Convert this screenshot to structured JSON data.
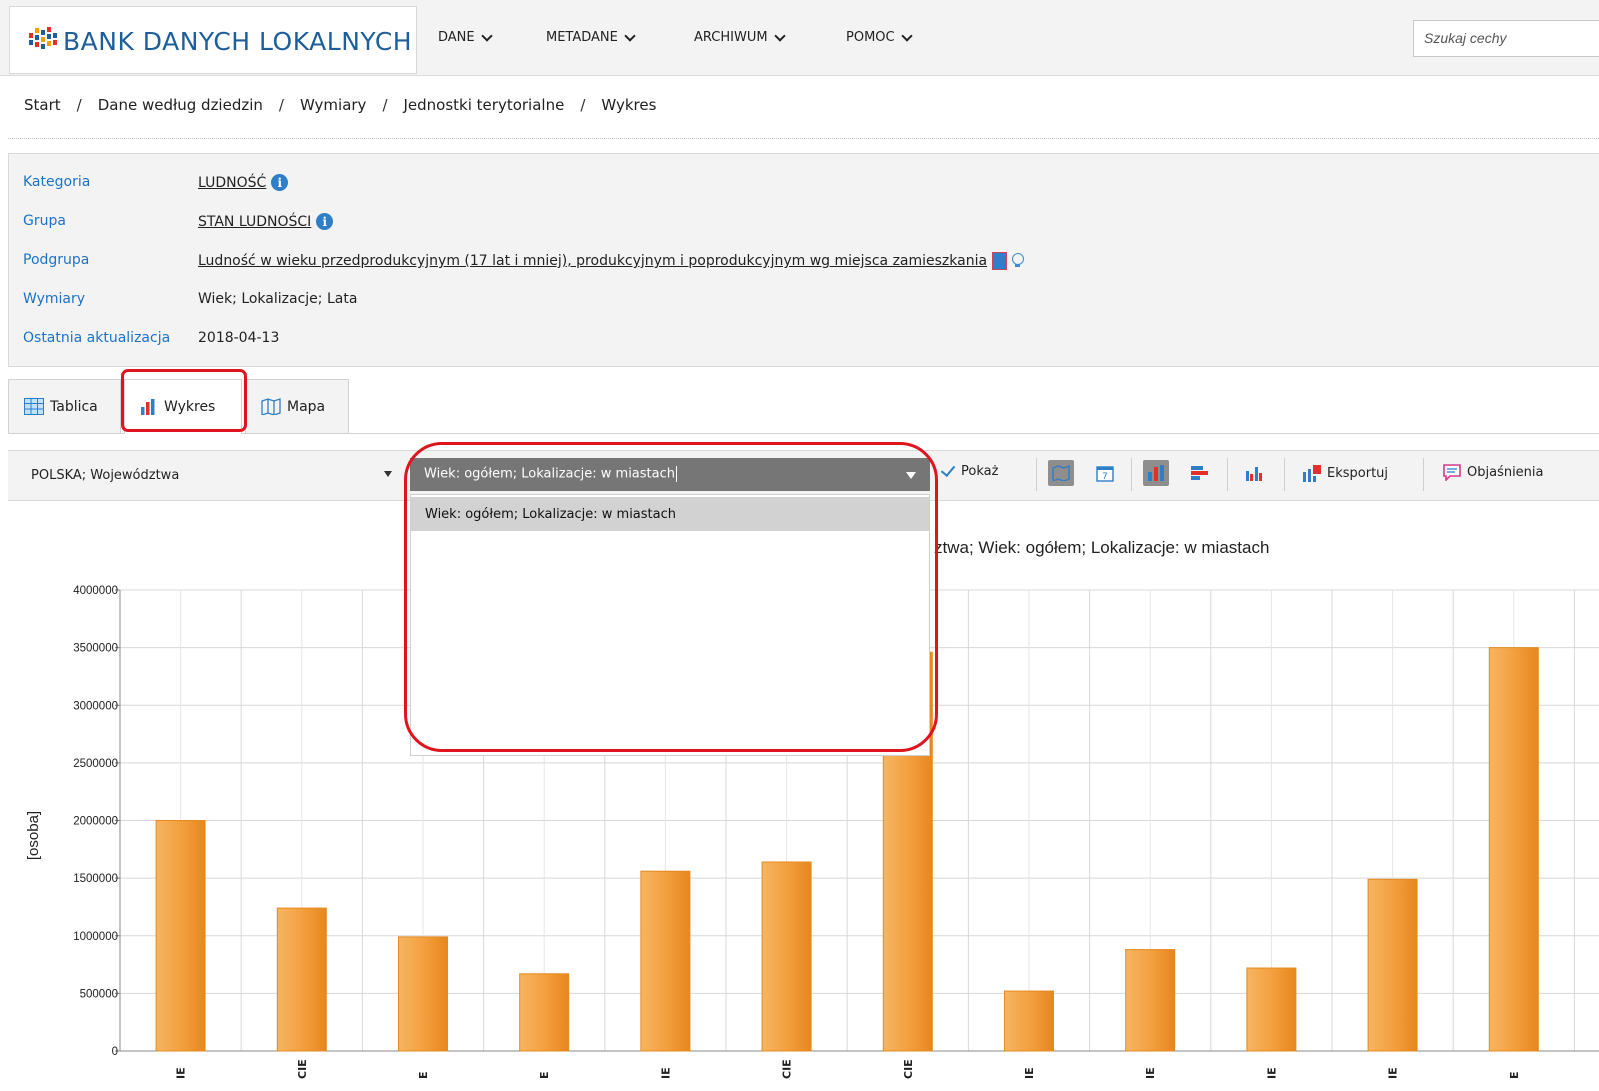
{
  "header": {
    "logo_text": "BANK DANYCH LOKALNYCH",
    "nav": [
      {
        "label": "DANE"
      },
      {
        "label": "METADANE"
      },
      {
        "label": "ARCHIWUM"
      },
      {
        "label": "POMOC"
      }
    ],
    "search_placeholder": "Szukaj cechy"
  },
  "breadcrumb": [
    "Start",
    "Dane według dziedzin",
    "Wymiary",
    "Jednostki terytorialne",
    "Wykres"
  ],
  "meta": {
    "kategoria_label": "Kategoria",
    "kategoria_value": "LUDNOŚĆ",
    "grupa_label": "Grupa",
    "grupa_value": "STAN LUDNOŚCI",
    "podgrupa_label": "Podgrupa",
    "podgrupa_value": "Ludność w wieku przedprodukcyjnym (17 lat i mniej), produkcyjnym i poprodukcyjnym wg miejsca zamieszkania",
    "wymiary_label": "Wymiary",
    "wymiary_value": "Wiek; Lokalizacje; Lata",
    "aktualizacja_label": "Ostatnia aktualizacja",
    "aktualizacja_value": "2018-04-13"
  },
  "tabs": [
    {
      "label": "Tablica"
    },
    {
      "label": "Wykres"
    },
    {
      "label": "Mapa"
    }
  ],
  "toolbar": {
    "territory_select": "POLSKA; Województwa",
    "dimension_select": "Wiek: ogółem; Lokalizacje: w miastach",
    "dropdown_option": "Wiek: ogółem; Lokalizacje: w miastach",
    "show_label": "Pokaż",
    "export_label": "Eksportuj",
    "explain_label": "Objaśnienia"
  },
  "colors": {
    "accent_blue": "#1e72c6",
    "bar_orange": "#f29b33",
    "highlight_red": "#e0141e"
  },
  "chart_data": {
    "type": "bar",
    "title_visible": "ztwa; Wiek: ogółem; Lokalizacje: w miastach",
    "ylabel": "[osoba]",
    "ylim": [
      0,
      4000000
    ],
    "yticks": [
      0,
      500000,
      1000000,
      1500000,
      2000000,
      2500000,
      3000000,
      3500000,
      4000000
    ],
    "xtick_fragments": [
      "IE",
      "CIE",
      "E",
      "E",
      "IE",
      "CIE",
      "CIE",
      "IE",
      "IE",
      "IE",
      "IE",
      "E"
    ],
    "values": [
      2000000,
      1240000,
      990000,
      670000,
      1560000,
      1640000,
      3460000,
      520000,
      880000,
      720000,
      1490000,
      3500000
    ]
  }
}
